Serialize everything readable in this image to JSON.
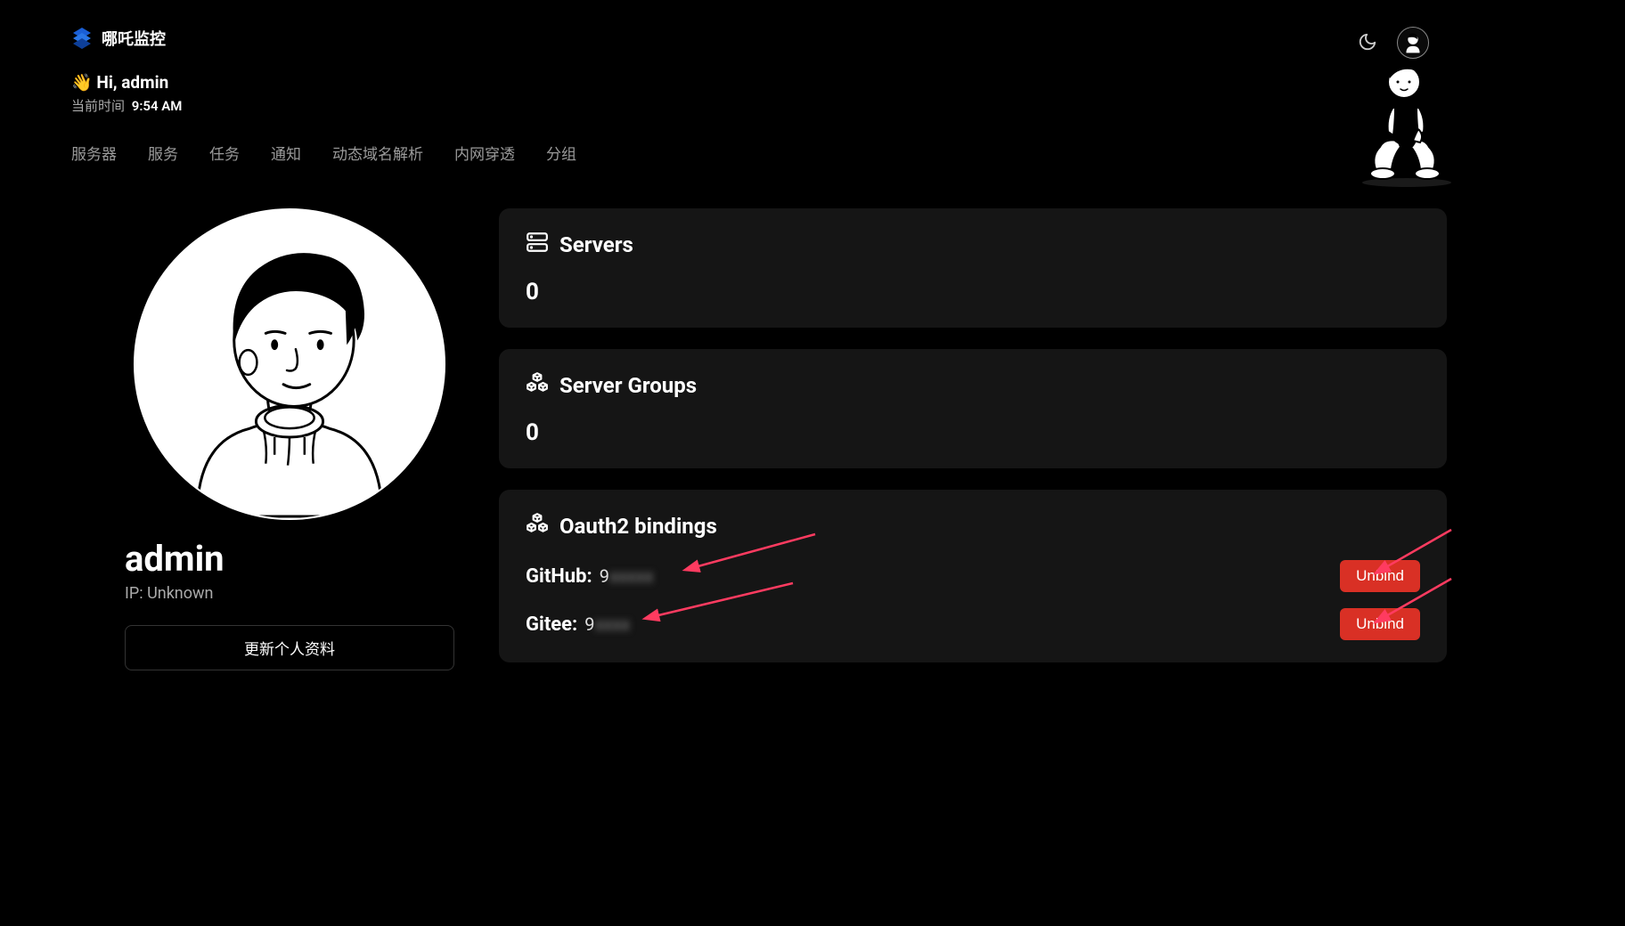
{
  "app": {
    "name": "哪吒监控"
  },
  "header": {
    "greeting_emoji": "👋",
    "greeting": "Hi, admin",
    "time_label": "当前时间",
    "time_value": "9:54 AM"
  },
  "nav": {
    "items": [
      "服务器",
      "服务",
      "任务",
      "通知",
      "动态域名解析",
      "内网穿透",
      "分组"
    ]
  },
  "profile": {
    "username": "admin",
    "ip_label": "IP: Unknown",
    "update_button": "更新个人资料"
  },
  "cards": {
    "servers": {
      "title": "Servers",
      "value": "0"
    },
    "server_groups": {
      "title": "Server Groups",
      "value": "0"
    },
    "oauth": {
      "title": "Oauth2 bindings",
      "bindings": [
        {
          "provider_label": "GitHub:",
          "id_prefix": "9",
          "unbind_label": "Unbind"
        },
        {
          "provider_label": "Gitee:",
          "id_prefix": "9",
          "unbind_label": "Unbind"
        }
      ]
    }
  }
}
